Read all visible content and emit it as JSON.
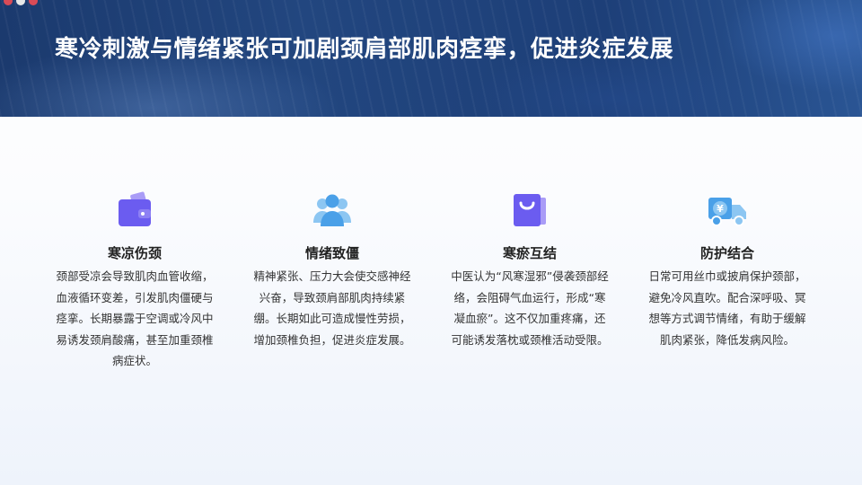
{
  "title": "寒冷刺激与情绪紧张可加剧颈肩部肌肉痉挛，促进炎症发展",
  "colors": {
    "banner": "#22467f",
    "icon_purple": "#6b5cf0",
    "icon_blue": "#4aa0e8",
    "text": "#333333"
  },
  "cards": [
    {
      "icon": "wallet-icon",
      "title": "寒凉伤颈",
      "text": "颈部受凉会导致肌肉血管收缩，血液循环变差，引发肌肉僵硬与痉挛。长期暴露于空调或冷风中易诱发颈肩酸痛，甚至加重颈椎病症状。"
    },
    {
      "icon": "users-icon",
      "title": "情绪致僵",
      "text": "精神紧张、压力大会使交感神经兴奋，导致颈肩部肌肉持续紧绷。长期如此可造成慢性劳损，增加颈椎负担，促进炎症发展。"
    },
    {
      "icon": "shopping-bag-icon",
      "title": "寒瘀互结",
      "text": "中医认为“风寒湿邪”侵袭颈部经络，会阻碍气血运行，形成“寒凝血瘀”。这不仅加重疼痛，还可能诱发落枕或颈椎活动受限。"
    },
    {
      "icon": "delivery-truck-icon",
      "title": "防护结合",
      "text": "日常可用丝巾或披肩保护颈部，避免冷风直吹。配合深呼吸、冥想等方式调节情绪，有助于缓解肌肉紧张，降低发病风险。"
    }
  ]
}
